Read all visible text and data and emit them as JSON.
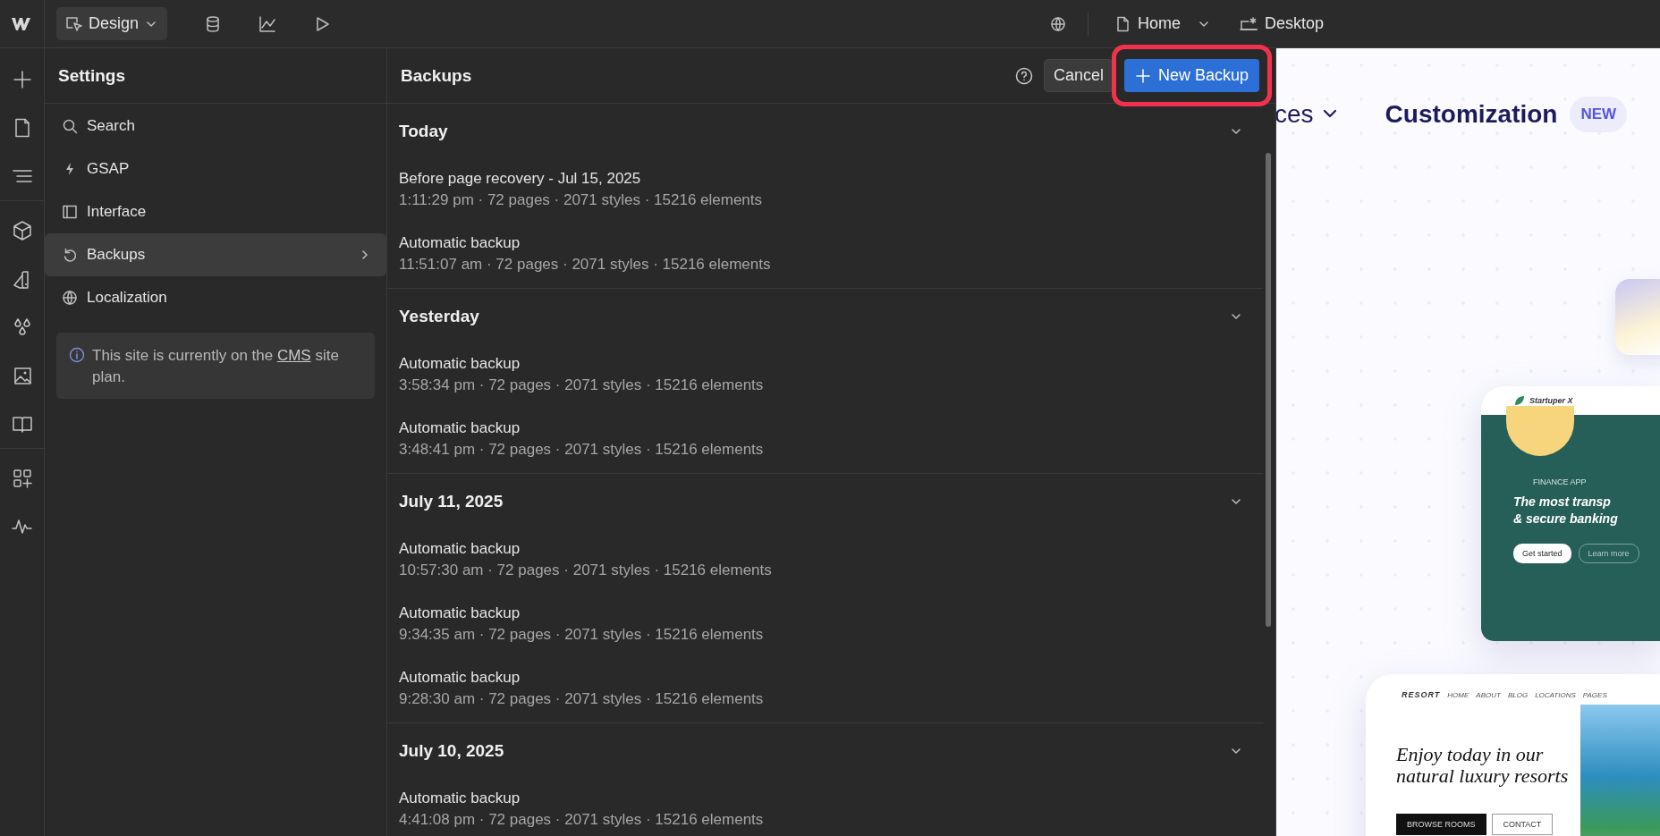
{
  "toolbar": {
    "mode": "Design",
    "page": "Home",
    "breakpoint": "Desktop"
  },
  "settings": {
    "title": "Settings",
    "items": [
      {
        "label": "Search",
        "selected": false
      },
      {
        "label": "GSAP",
        "selected": false
      },
      {
        "label": "Interface",
        "selected": false
      },
      {
        "label": "Backups",
        "selected": true
      },
      {
        "label": "Localization",
        "selected": false
      }
    ],
    "notice": {
      "before": "This site is currently on the ",
      "link": "CMS",
      "after": " site plan."
    }
  },
  "backups": {
    "title": "Backups",
    "cancel": "Cancel",
    "new_backup": "New Backup",
    "highlighted": true,
    "groups": [
      {
        "label": "Today",
        "expanded": true,
        "entries": [
          {
            "name": "Before page recovery - Jul 15, 2025",
            "details": "1:11:29 pm · 72 pages · 2071 styles · 15216 elements"
          },
          {
            "name": "Automatic backup",
            "details": "11:51:07 am · 72 pages · 2071 styles · 15216 elements"
          }
        ]
      },
      {
        "label": "Yesterday",
        "expanded": true,
        "entries": [
          {
            "name": "Automatic backup",
            "details": "3:58:34 pm · 72 pages · 2071 styles · 15216 elements"
          },
          {
            "name": "Automatic backup",
            "details": "3:48:41 pm · 72 pages · 2071 styles · 15216 elements"
          }
        ]
      },
      {
        "label": "July 11, 2025",
        "expanded": true,
        "entries": [
          {
            "name": "Automatic backup",
            "details": "10:57:30 am · 72 pages · 2071 styles · 15216 elements"
          },
          {
            "name": "Automatic backup",
            "details": "9:34:35 am · 72 pages · 2071 styles · 15216 elements"
          },
          {
            "name": "Automatic backup",
            "details": "9:28:30 am · 72 pages · 2071 styles · 15216 elements"
          }
        ]
      },
      {
        "label": "July 10, 2025",
        "expanded": true,
        "entries": [
          {
            "name": "Automatic backup",
            "details": "4:41:08 pm · 72 pages · 2071 styles · 15216 elements"
          }
        ]
      }
    ]
  },
  "canvas": {
    "nav_partial": "ces",
    "nav_link": "Customization",
    "badge": "NEW",
    "finance_card": {
      "brand": "Startuper X",
      "eyebrow": "FINANCE APP",
      "headline_1": "The most transp",
      "headline_2": "& secure banking",
      "primary": "Get started",
      "secondary": "Learn more"
    },
    "resort_card": {
      "brand": "RESORT",
      "nav": [
        "HOME",
        "ABOUT",
        "BLOG",
        "LOCATIONS",
        "PAGES"
      ],
      "headline_1": "Enjoy today in our",
      "headline_2": "natural luxury resorts",
      "primary": "BROWSE ROOMS",
      "secondary": "CONTACT"
    }
  }
}
